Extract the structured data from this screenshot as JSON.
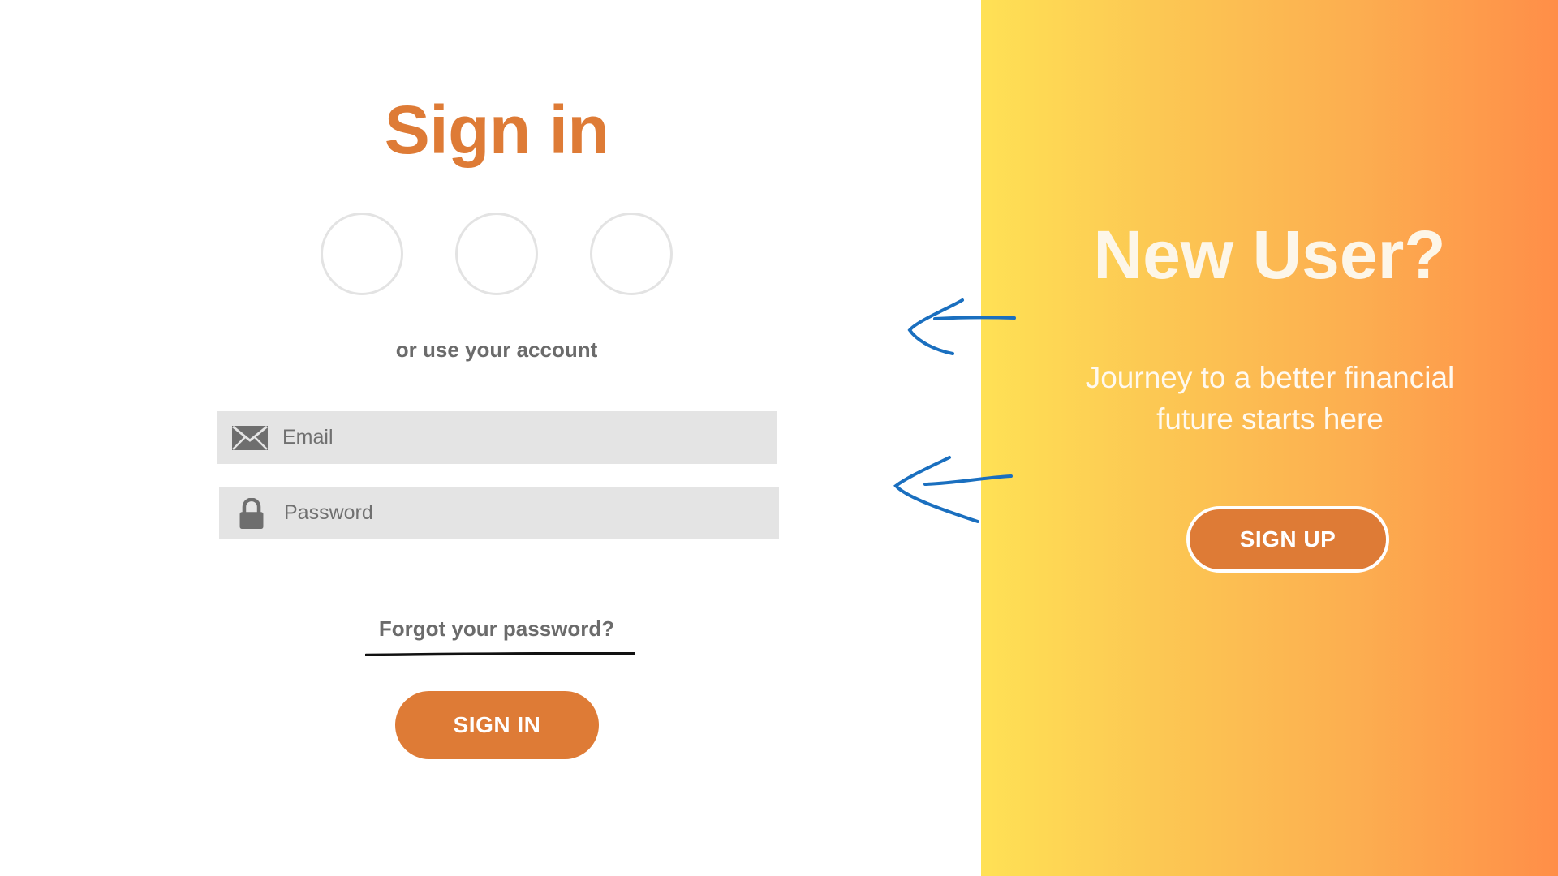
{
  "signin": {
    "title": "Sign in",
    "social_icons": [
      "social-login-1",
      "social-login-2",
      "social-login-3"
    ],
    "subtitle": "or use your account",
    "email": {
      "placeholder": "Email",
      "icon": "envelope-icon"
    },
    "password": {
      "placeholder": "Password",
      "icon": "lock-icon"
    },
    "forgot_label": "Forgot your password?",
    "button_label": "SIGN IN"
  },
  "signup": {
    "title": "New User?",
    "tagline_line1": "Journey to a better financial",
    "tagline_line2": "future starts here",
    "button_label": "SIGN UP"
  },
  "colors": {
    "accent": "#de7b36",
    "gradient_start": "#ffe155",
    "gradient_end": "#ff8e48",
    "field_bg": "#e4e4e4",
    "annotation": "#1a6fbf"
  }
}
